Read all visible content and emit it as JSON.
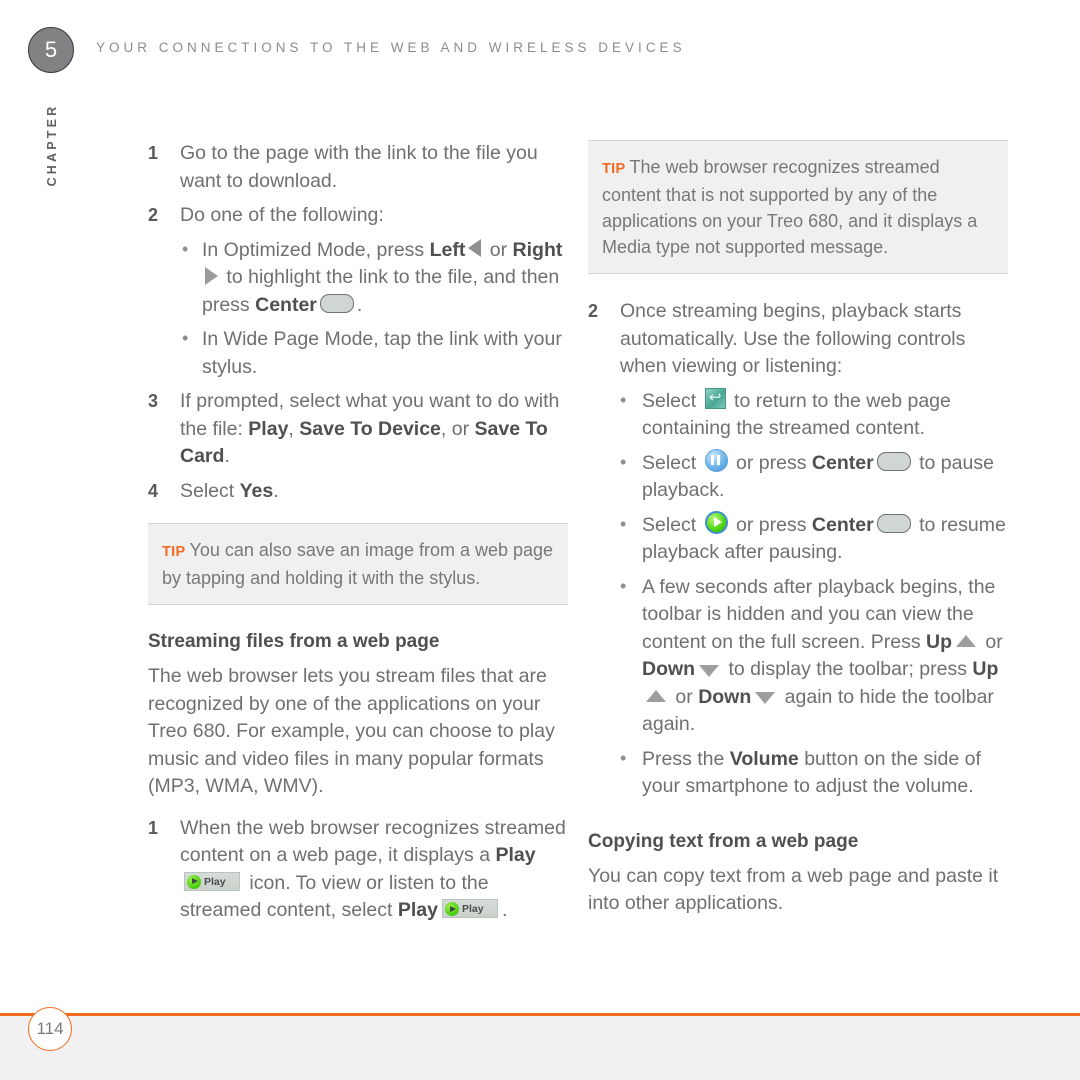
{
  "header": {
    "chapter_number": "5",
    "title": "YOUR CONNECTIONS TO THE WEB AND WIRELESS DEVICES",
    "chapter_label": "CHAPTER"
  },
  "footer": {
    "page_number": "114",
    "rule_color": "#f26b21"
  },
  "colors": {
    "accent_orange": "#f26b21",
    "body_text": "#6e7072",
    "bold_text": "#4e5052",
    "tip_background": "#f0f0f0"
  },
  "left_column": {
    "step1": {
      "num": "1",
      "text": "Go to the page with the link to the file you want to download."
    },
    "step2": {
      "num": "2",
      "text": "Do one of the following:"
    },
    "bullet_optimized": {
      "part1": "In Optimized Mode, press ",
      "bold1": "Left",
      "part2": " or ",
      "bold2": "Right",
      "part3": " to highlight the link to the file, and then press ",
      "bold3": "Center",
      "part4": "."
    },
    "bullet_wide": {
      "text": "In Wide Page Mode, tap the link with your stylus."
    },
    "step3": {
      "num": "3",
      "part1": "If prompted, select what you want to do with the file: ",
      "bold1": "Play",
      "part2": ", ",
      "bold2": "Save To Device",
      "part3": ", or ",
      "bold3": "Save To Card",
      "part4": "."
    },
    "step4": {
      "num": "4",
      "part1": "Select ",
      "bold1": "Yes",
      "part2": "."
    },
    "tip": {
      "label": "TIP",
      "text": "You can also save an image from a web page by tapping and holding it with the stylus."
    },
    "heading": "Streaming files from a web page",
    "intro": "The web browser lets you stream files that are recognized by one of the applications on your Treo 680. For example, you can choose to play music and video files in many popular formats (MP3, WMA, WMV).",
    "step_stream_1": {
      "num": "1",
      "part1": "When the web browser recognizes streamed content on a web page, it displays a ",
      "bold1": "Play",
      "part2": " icon. To view or listen to the streamed content, select ",
      "bold2": "Play",
      "part3": "."
    },
    "play_chip_label": "Play"
  },
  "right_column": {
    "tip": {
      "label": "TIP",
      "text": "The web browser recognizes streamed content that is not supported by any of the applications on your Treo 680, and it displays a Media type not supported message."
    },
    "step2": {
      "num": "2",
      "text": "Once streaming begins, playback starts automatically. Use the following controls when viewing or listening:"
    },
    "bullet_return": {
      "part1": "Select ",
      "part2": " to return to the web page containing the streamed content."
    },
    "bullet_pause": {
      "part1": "Select ",
      "part2": " or press ",
      "bold1": "Center",
      "part3": " to pause playback."
    },
    "bullet_resume": {
      "part1": "Select ",
      "part2": " or press ",
      "bold1": "Center",
      "part3": " to resume playback after pausing."
    },
    "bullet_toolbar": {
      "part1": "A few seconds after playback begins, the toolbar is hidden and you can view the content on the full screen. Press ",
      "bold1": "Up",
      "part2": " or ",
      "bold2": "Down",
      "part3": " to display the toolbar; press ",
      "bold3": "Up",
      "part4": " or ",
      "bold4": "Down",
      "part5": " again to hide the toolbar again."
    },
    "bullet_volume": {
      "part1": "Press the ",
      "bold1": "Volume",
      "part2": " button on the side of your smartphone to adjust the volume."
    },
    "heading": "Copying text from a web page",
    "body": "You can copy text from a web page and paste it into other applications."
  }
}
